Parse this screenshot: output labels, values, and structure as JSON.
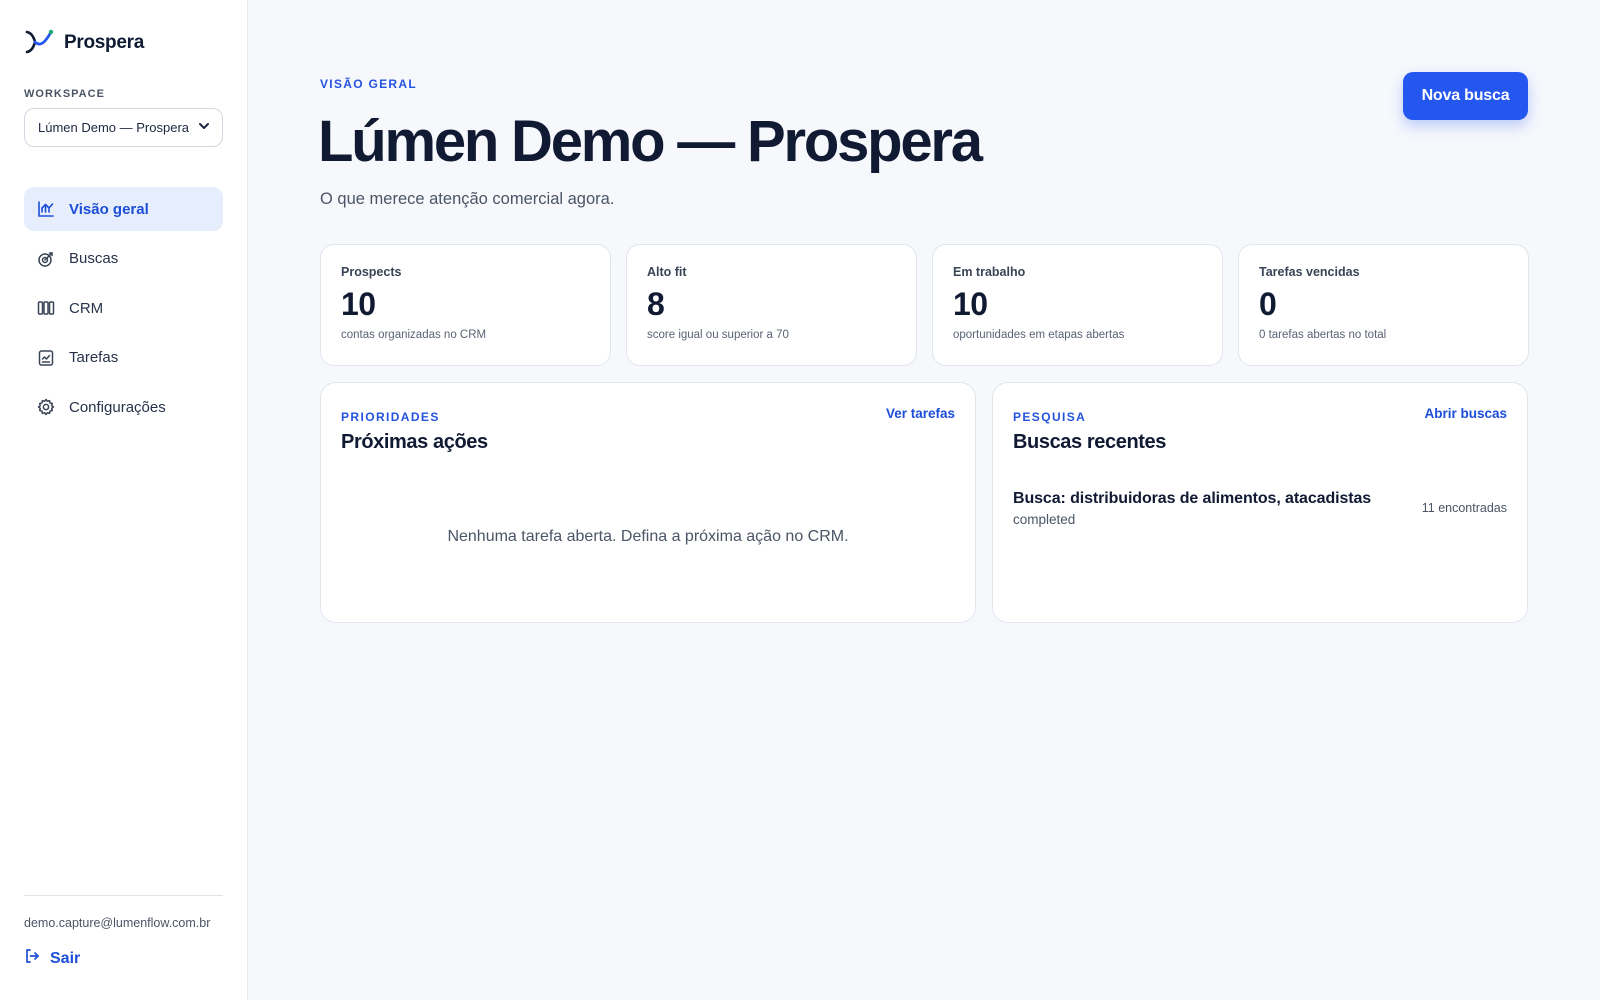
{
  "brand": {
    "name": "Prospera"
  },
  "workspace": {
    "label": "WORKSPACE",
    "selected": "Lúmen Demo — Prospera"
  },
  "nav": {
    "items": [
      {
        "label": "Visão geral",
        "icon": "chart-icon",
        "active": true
      },
      {
        "label": "Buscas",
        "icon": "target-icon",
        "active": false
      },
      {
        "label": "CRM",
        "icon": "kanban-icon",
        "active": false
      },
      {
        "label": "Tarefas",
        "icon": "clipboard-icon",
        "active": false
      },
      {
        "label": "Configurações",
        "icon": "gear-icon",
        "active": false
      }
    ]
  },
  "user": {
    "email": "demo.capture@lumenflow.com.br",
    "logout_label": "Sair"
  },
  "header": {
    "eyebrow": "VISÃO GERAL",
    "title": "Lúmen Demo — Prospera",
    "subtitle": "O que merece atenção comercial agora.",
    "primary_action": "Nova busca"
  },
  "stats": [
    {
      "label": "Prospects",
      "value": "10",
      "note": "contas organizadas no CRM"
    },
    {
      "label": "Alto fit",
      "value": "8",
      "note": "score igual ou superior a 70"
    },
    {
      "label": "Em trabalho",
      "value": "10",
      "note": "oportunidades em etapas abertas"
    },
    {
      "label": "Tarefas vencidas",
      "value": "0",
      "note": "0 tarefas abertas no total"
    }
  ],
  "priorities": {
    "eyebrow": "PRIORIDADES",
    "title": "Próximas ações",
    "link": "Ver tarefas",
    "empty": "Nenhuma tarefa aberta. Defina a próxima ação no CRM."
  },
  "searches": {
    "eyebrow": "PESQUISA",
    "title": "Buscas recentes",
    "link": "Abrir buscas",
    "items": [
      {
        "title": "Busca: distribuidoras de alimentos, atacadistas",
        "status": "completed",
        "count": "11 encontradas"
      }
    ]
  },
  "colors": {
    "accent": "#2456f0",
    "link": "#1d4ed8",
    "active_nav_bg": "#e6eefe",
    "page_bg": "#f6f8fc"
  }
}
